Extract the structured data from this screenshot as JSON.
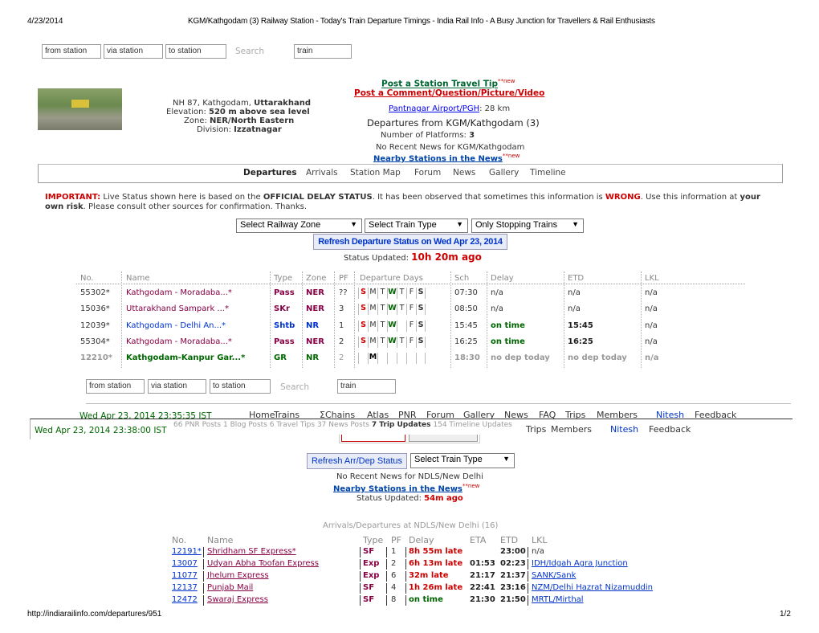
{
  "print_header": {
    "date": "4/23/2014",
    "title": "KGM/Kathgodam (3) Railway Station - Today's Train Departure Timings - India Rail Info - A Busy Junction for Travellers & Rail Enthusiasts"
  },
  "print_footer": {
    "url": "http://indiarailinfo.com/departures/951",
    "page": "1/2"
  },
  "search": {
    "from": "from station",
    "via": "via station",
    "to": "to station",
    "button": "Search",
    "train": "train"
  },
  "station": {
    "post_tip": "Post a Station Travel Tip",
    "post_tip_new": "**new",
    "post_comment": "Post a Comment/Question/Picture/Video",
    "address_prefix": "NH 87, Kathgodam, ",
    "address_state": "Uttarakhand",
    "elev_label": "Elevation: ",
    "elev_value": "520 m above sea level",
    "zone_label": "Zone: ",
    "zone_value": "NER/North Eastern",
    "div_label": "Division: ",
    "div_value": "Izzatnagar",
    "airport_link": "Pantnagar Airport/PGH",
    "airport_dist": ": 28 km",
    "departures_title": "Departures from KGM/Kathgodam (3)",
    "platforms_label": "Number of Platforms: ",
    "platforms_value": "3",
    "news": "No Recent News for KGM/Kathgodam",
    "nearby": "Nearby Stations in the News",
    "nearby_new": "**new"
  },
  "tabs": [
    "Departures",
    "Arrivals",
    "Station Map",
    "Forum",
    "News",
    "Gallery",
    "Timeline"
  ],
  "notice": {
    "important": "IMPORTANT:",
    "t1": " Live Status shown here is based on the ",
    "official": "OFFICIAL DELAY STATUS",
    "t2": ". It has been observed that sometimes this information is ",
    "wrong": "WRONG",
    "t3": ". Use this information at ",
    "own": "your own risk",
    "t4": ". Please consult other sources for confirmation. Thanks."
  },
  "filters": {
    "zone": "Select Railway Zone",
    "type": "Select Train Type",
    "stop": "Only Stopping Trains"
  },
  "refresh": "Refresh Departure Status on Wed Apr 23, 2014",
  "status": {
    "label": "Status Updated: ",
    "value": "10h 20m ago"
  },
  "table": {
    "headers": [
      "No.",
      "Name",
      "Type",
      "Zone",
      "PF",
      "Departure Days",
      "Sch",
      "Delay",
      "ETD",
      "LKL"
    ],
    "days": [
      "S",
      "M",
      "T",
      "W",
      "T",
      "F",
      "S"
    ],
    "rows": [
      {
        "no": "55302*",
        "name": "Kathgodam - Moradaba...*",
        "type": "Pass",
        "zone": "NER",
        "pf": "??",
        "days": [
          1,
          1,
          1,
          1,
          1,
          1,
          1
        ],
        "sch": "07:30",
        "delay": "n/a",
        "etd": "n/a",
        "lkl": "n/a"
      },
      {
        "no": "15036*",
        "name": "Uttarakhand Sampark ...*",
        "type": "SKr",
        "zone": "NER",
        "pf": "3",
        "days": [
          1,
          1,
          1,
          1,
          1,
          1,
          1
        ],
        "sch": "08:50",
        "delay": "n/a",
        "etd": "n/a",
        "lkl": "n/a"
      },
      {
        "no": "12039*",
        "name": "Kathgodam - Delhi An...*",
        "type": "Shtb",
        "zone": "NR",
        "pf": "1",
        "days": [
          1,
          1,
          1,
          1,
          0,
          1,
          1
        ],
        "sch": "15:45",
        "delay": "on time",
        "etd": "15:45",
        "lkl": "n/a"
      },
      {
        "no": "55304*",
        "name": "Kathgodam - Moradaba...*",
        "type": "Pass",
        "zone": "NER",
        "pf": "2",
        "days": [
          1,
          1,
          1,
          1,
          1,
          1,
          1
        ],
        "sch": "16:25",
        "delay": "on time",
        "etd": "16:25",
        "lkl": "n/a"
      },
      {
        "no": "12210*",
        "name": "Kathgodam-Kanpur Gar...*",
        "type": "GR",
        "zone": "NR",
        "pf": "2",
        "days": [
          0,
          1,
          0,
          0,
          0,
          0,
          0
        ],
        "sch": "18:30",
        "delay": "no dep today",
        "etd": "no dep today",
        "lkl": "n/a"
      }
    ]
  },
  "overlay": {
    "ts1": "Wed Apr 23, 2014 23:35:35 IST",
    "ts2": "Wed Apr 23, 2014 23:38:00 IST",
    "nav": [
      "Home",
      "Trains",
      "ΣChains",
      "Atlas",
      "PNR",
      "Forum",
      "Gallery",
      "News",
      "FAQ",
      "Trips",
      "Members"
    ],
    "user": "Nitesh",
    "feedback": "Feedback",
    "counts": {
      "pnr": "66 PNR Posts",
      "blog": "1 Blog Posts",
      "tips": "6 Travel Tips",
      "news": "37 News Posts",
      "trips": "7 Trip Updates",
      "tl": "154 Timeline Updates"
    },
    "refresh_arrdep": "Refresh Arr/Dep Status",
    "train_type": "Select Train Type",
    "news": "No Recent News for NDLS/New Delhi",
    "nearby": "Nearby Stations in the News",
    "nearby_new": "**new",
    "status_label": "Status Updated: ",
    "status_value": "54m ago",
    "arrdep_title": "Arrivals/Departures at NDLS/New Delhi (16)",
    "headers": [
      "No.",
      "Name",
      "Type",
      "PF",
      "Delay",
      "ETA",
      "ETD",
      "LKL"
    ],
    "rows": [
      {
        "no": "12191*",
        "name": "Shridham SF Express*",
        "type": "SF",
        "pf": "1",
        "delay": "8h 55m late",
        "eta": "",
        "etd": "23:00",
        "lkl": "n/a"
      },
      {
        "no": "13007",
        "name": "Udyan Abha Toofan Express",
        "type": "Exp",
        "pf": "2",
        "delay": "6h 13m late",
        "eta": "01:53",
        "etd": "02:23",
        "lkl": "IDH/Idgah Agra Junction"
      },
      {
        "no": "11077",
        "name": "Jhelum Express",
        "type": "Exp",
        "pf": "6",
        "delay": "32m late",
        "eta": "21:17",
        "etd": "21:37",
        "lkl": "SANK/Sank"
      },
      {
        "no": "12137",
        "name": "Punjab Mail",
        "type": "SF",
        "pf": "4",
        "delay": "1h 26m late",
        "eta": "22:41",
        "etd": "23:16",
        "lkl": "NZM/Delhi Hazrat Nizamuddin"
      },
      {
        "no": "12472",
        "name": "Swaraj Express",
        "type": "SF",
        "pf": "8",
        "delay": "on time",
        "eta": "21:30",
        "etd": "21:50",
        "lkl": "MRTL/Mirthal"
      }
    ]
  }
}
